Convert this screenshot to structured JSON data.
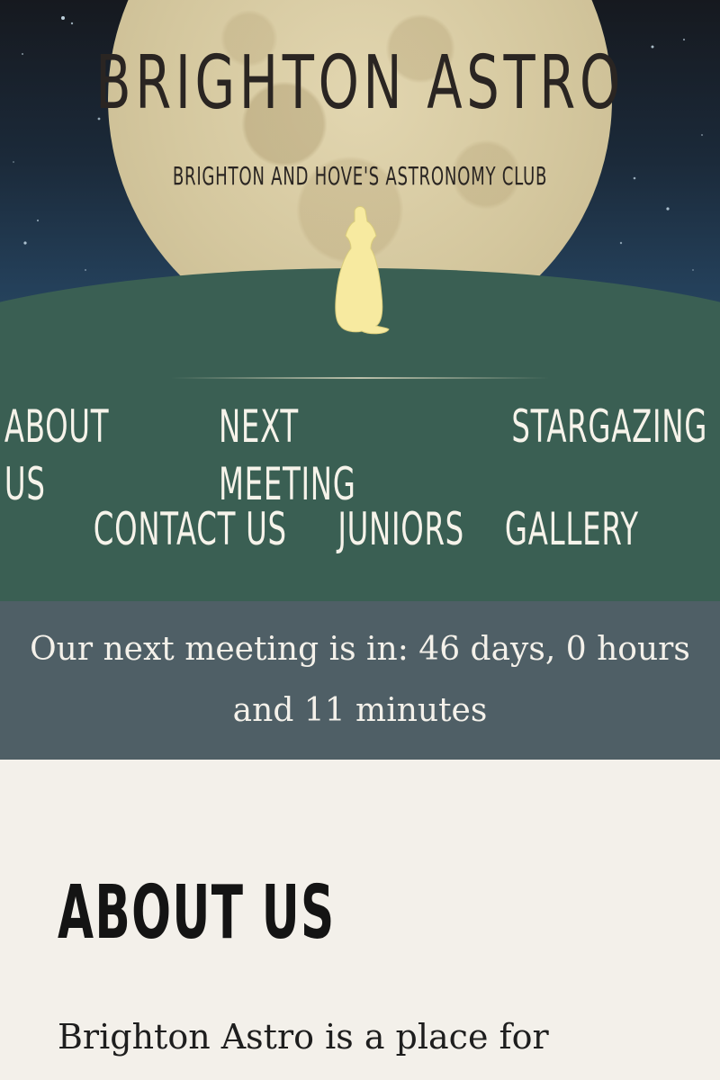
{
  "header": {
    "title": "BRIGHTON ASTRO",
    "tagline": "BRIGHTON AND HOVE'S ASTRONOMY CLUB"
  },
  "nav": {
    "items": [
      {
        "label": "ABOUT US"
      },
      {
        "label": "NEXT MEETING"
      },
      {
        "label": "STARGAZING"
      },
      {
        "label": "CONTACT US"
      },
      {
        "label": "JUNIORS"
      },
      {
        "label": "GALLERY"
      }
    ]
  },
  "countdown": {
    "text": "Our next meeting is in: 46 days, 0 hours and 11 minutes"
  },
  "about": {
    "heading": "ABOUT US",
    "intro": "Brighton Astro is a place for cosmic"
  },
  "colors": {
    "sky": "#1b2a3a",
    "moon": "#d4c79e",
    "hill": "#3a5f53",
    "countdown_bg": "#4f5f66",
    "page_bg": "#f3f0ea",
    "dog": "#f7eaa0"
  }
}
